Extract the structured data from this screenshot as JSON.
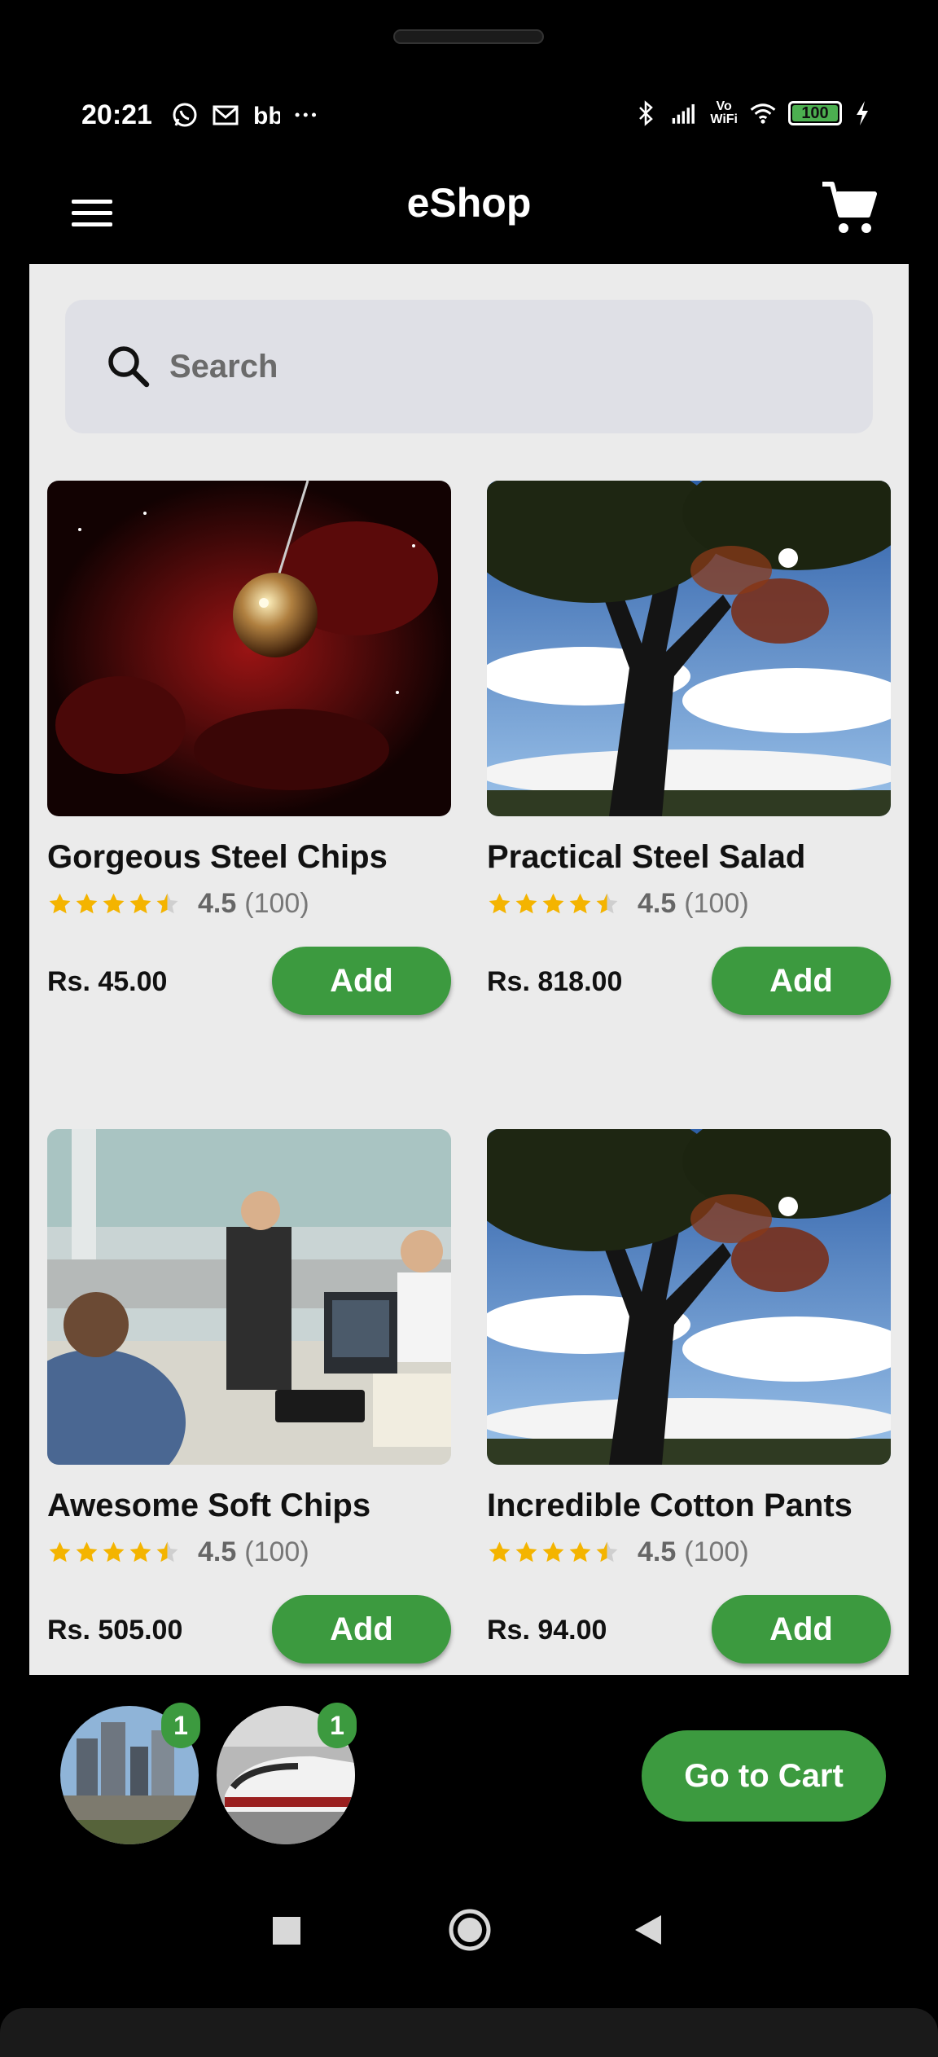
{
  "status_bar": {
    "time": "20:21",
    "battery": "100",
    "vowifi_top": "Vo",
    "vowifi_bottom": "WiFi",
    "icons": [
      "whatsapp-icon",
      "gmail-icon",
      "bb-icon",
      "more-dots-icon",
      "bluetooth-icon",
      "signal-icon",
      "vowifi-icon",
      "wifi-icon",
      "battery-icon",
      "charging-icon"
    ]
  },
  "app_bar": {
    "title": "eShop",
    "menu_icon": "menu-icon",
    "cart_icon": "cart-icon"
  },
  "search": {
    "placeholder": "Search",
    "icon": "search-icon"
  },
  "products": [
    {
      "name": "Gorgeous Steel Chips",
      "rating": "4.5",
      "count": "(100)",
      "stars": 4.5,
      "price": "Rs. 45.00",
      "add_label": "Add"
    },
    {
      "name": "Practical Steel Salad",
      "rating": "4.5",
      "count": "(100)",
      "stars": 4.5,
      "price": "Rs. 818.00",
      "add_label": "Add"
    },
    {
      "name": "Awesome Soft Chips",
      "rating": "4.5",
      "count": "(100)",
      "stars": 4.5,
      "price": "Rs. 505.00",
      "add_label": "Add"
    },
    {
      "name": "Incredible Cotton Pants",
      "rating": "4.5",
      "count": "(100)",
      "stars": 4.5,
      "price": "Rs. 94.00",
      "add_label": "Add"
    }
  ],
  "cart_preview": {
    "items": [
      {
        "badge": "1"
      },
      {
        "badge": "1"
      }
    ],
    "go_to_cart_label": "Go to Cart"
  },
  "colors": {
    "accent": "#3c9a3f",
    "star": "#f4b400",
    "background": "#ebebeb"
  }
}
